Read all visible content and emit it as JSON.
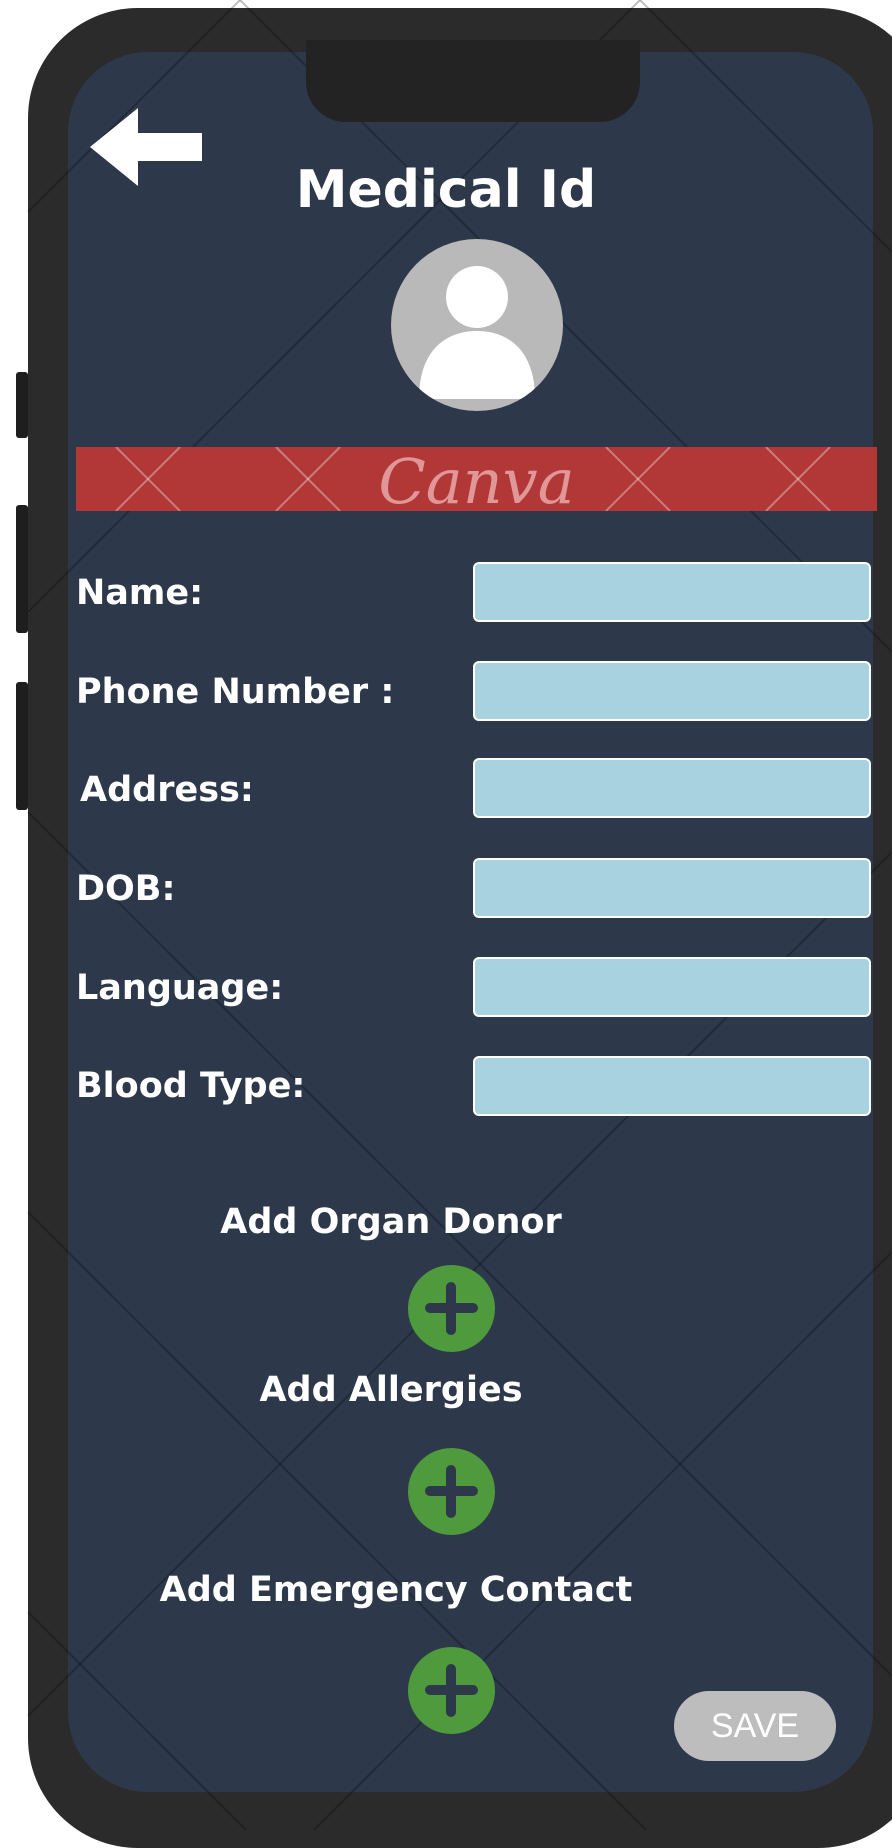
{
  "page": {
    "title": "Medical Id"
  },
  "banner": {
    "text": "Canva"
  },
  "fields": [
    {
      "label": "Name:",
      "value": ""
    },
    {
      "label": "Phone Number :",
      "value": ""
    },
    {
      "label": "Address:",
      "value": ""
    },
    {
      "label": "DOB:",
      "value": ""
    },
    {
      "label": "Language:",
      "value": ""
    },
    {
      "label": "Blood Type:",
      "value": ""
    }
  ],
  "sections": [
    {
      "label": "Add Organ Donor",
      "icon": "plus-icon"
    },
    {
      "label": "Add Allergies",
      "icon": "plus-icon"
    },
    {
      "label": "Add Emergency Contact",
      "icon": "plus-icon"
    }
  ],
  "actions": {
    "save_label": "SAVE",
    "back_icon": "back-arrow-icon"
  },
  "colors": {
    "screen_bg": "#2d394b",
    "input_bg": "#a8d2e0",
    "banner_bg": "#b23737",
    "add_button": "#4e9a3c",
    "save_button": "#bdbdbd"
  }
}
